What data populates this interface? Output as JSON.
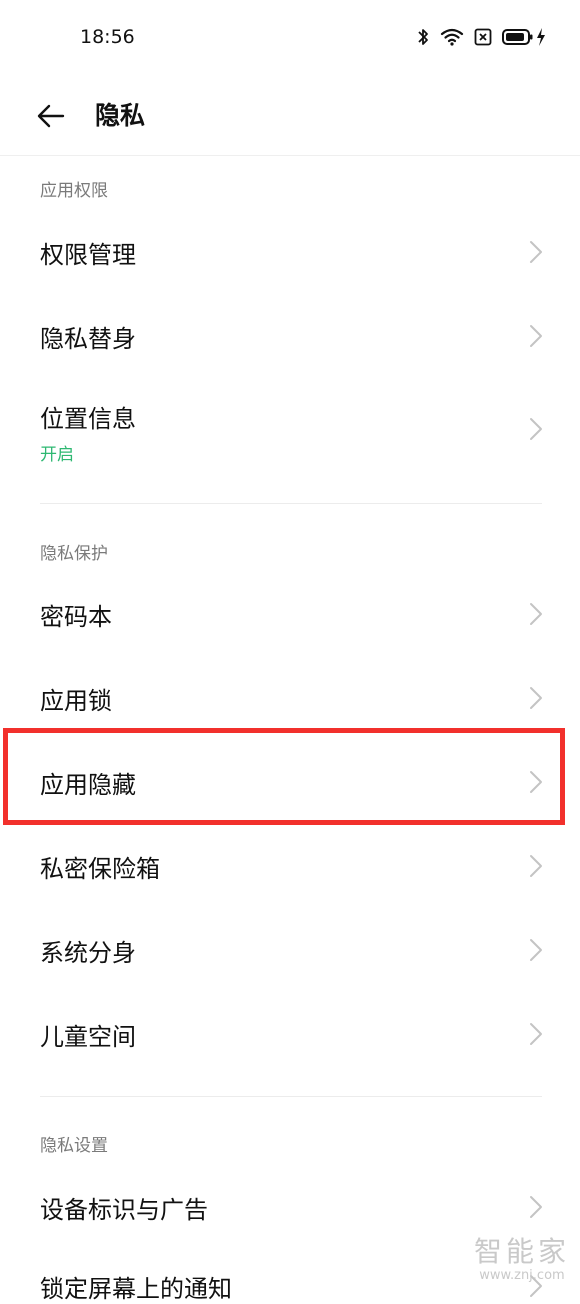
{
  "status_bar": {
    "time": "18:56",
    "icons": [
      "bluetooth-icon",
      "wifi-icon",
      "sim-absent-icon",
      "battery-icon",
      "charging-icon"
    ]
  },
  "header": {
    "back_icon": "arrow-left-icon",
    "title": "隐私"
  },
  "sections": [
    {
      "title": "应用权限",
      "items": [
        {
          "label": "权限管理"
        },
        {
          "label": "隐私替身"
        },
        {
          "label": "位置信息",
          "sub": "开启"
        }
      ]
    },
    {
      "title": "隐私保护",
      "items": [
        {
          "label": "密码本"
        },
        {
          "label": "应用锁"
        },
        {
          "label": "应用隐藏"
        },
        {
          "label": "私密保险箱"
        },
        {
          "label": "系统分身"
        },
        {
          "label": "儿童空间"
        }
      ]
    },
    {
      "title": "隐私设置",
      "items": [
        {
          "label": "设备标识与广告"
        },
        {
          "label": "锁定屏幕上的通知"
        }
      ]
    }
  ],
  "colors": {
    "accent_green": "#2eb872",
    "highlight_red": "#f2302c",
    "section_gray": "#7a7a7a"
  },
  "watermark": {
    "main": "智能家",
    "sub": "www.znj.com"
  }
}
